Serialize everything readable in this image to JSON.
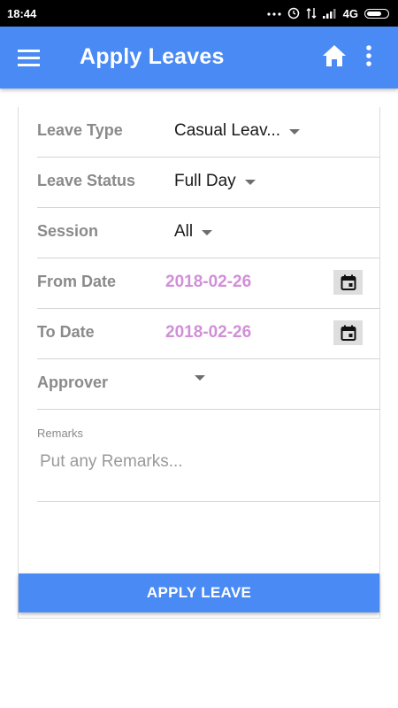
{
  "status_bar": {
    "time": "18:44",
    "network": "4G",
    "icons": [
      "more-dots-icon",
      "alarm-icon",
      "data-arrows-icon",
      "signal-icon",
      "battery-icon"
    ]
  },
  "app_bar": {
    "title": "Apply Leaves",
    "color": "#4a8af4",
    "icons": [
      "menu-icon",
      "home-icon",
      "more-vert-icon"
    ]
  },
  "form": {
    "leave_type": {
      "label": "Leave Type",
      "value": "Casual Leav..."
    },
    "leave_status": {
      "label": "Leave Status",
      "value": "Full Day"
    },
    "session": {
      "label": "Session",
      "value": "All"
    },
    "from_date": {
      "label": "From Date",
      "value": "2018-02-26"
    },
    "to_date": {
      "label": "To Date",
      "value": "2018-02-26"
    },
    "approver": {
      "label": "Approver",
      "value": ""
    },
    "remarks": {
      "label": "Remarks",
      "value": "",
      "placeholder": "Put any Remarks..."
    },
    "date_color": "#d18fd8"
  },
  "actions": {
    "apply_label": "APPLY LEAVE"
  }
}
